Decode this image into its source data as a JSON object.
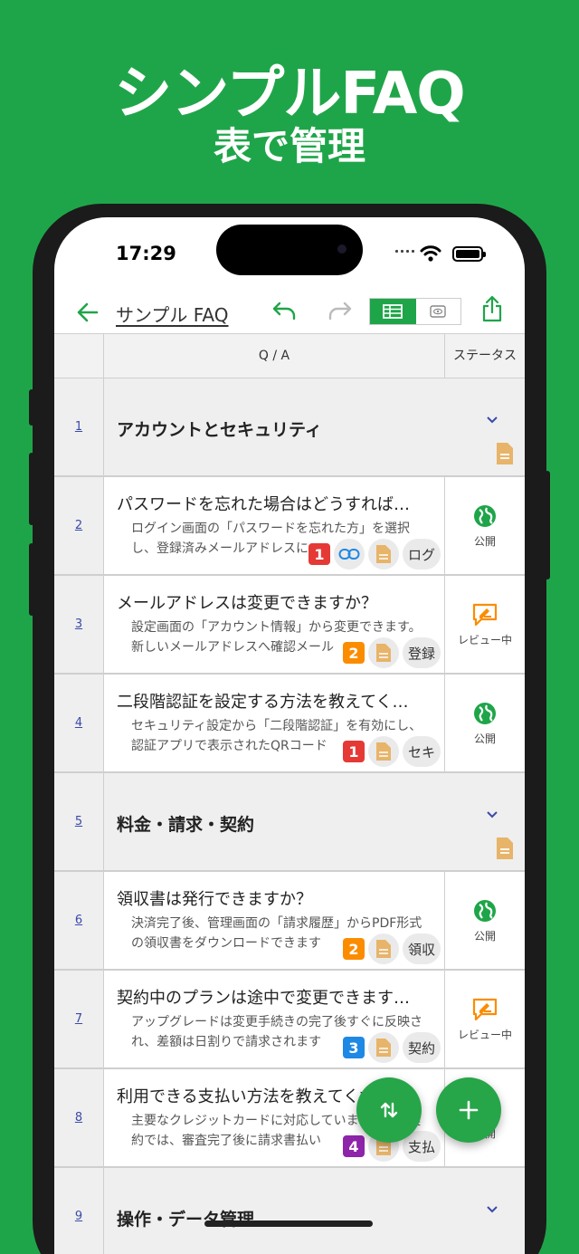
{
  "hero": {
    "title": "シンプルFAQ",
    "subtitle": "表で管理"
  },
  "status_bar": {
    "time": "17:29"
  },
  "toolbar": {
    "title": "サンプル FAQ"
  },
  "table": {
    "header": {
      "qa": "Q / A",
      "status": "ステータス"
    },
    "rows": [
      {
        "num": "1",
        "type": "section",
        "title": "アカウントとセキュリティ"
      },
      {
        "num": "2",
        "type": "item",
        "q": "パスワードを忘れた場合はどうすれば…",
        "a": "ログイン画面の「パスワードを忘れた方」を選択し、登録済みメールアドレスに",
        "badge": "1",
        "badge_color": "#e53935",
        "has_link": true,
        "tag": "ログ",
        "status": "公開",
        "status_icon": "globe-icon"
      },
      {
        "num": "3",
        "type": "item",
        "q": "メールアドレスは変更できますか？",
        "a": "設定画面の「アカウント情報」から変更できます。新しいメールアドレスへ確認メール",
        "badge": "2",
        "badge_color": "#fb8c00",
        "has_link": false,
        "tag": "登録",
        "status": "レビュー中",
        "status_icon": "review-icon"
      },
      {
        "num": "4",
        "type": "item",
        "q": "二段階認証を設定する方法を教えてく…",
        "a": "セキュリティ設定から「二段階認証」を有効にし、認証アプリで表示されたQRコード",
        "badge": "1",
        "badge_color": "#e53935",
        "has_link": false,
        "tag": "セキ",
        "status": "公開",
        "status_icon": "globe-icon"
      },
      {
        "num": "5",
        "type": "section",
        "title": "料金・請求・契約"
      },
      {
        "num": "6",
        "type": "item",
        "q": "領収書は発行できますか？",
        "a": "決済完了後、管理画面の「請求履歴」からPDF形式の領収書をダウンロードできます",
        "badge": "2",
        "badge_color": "#fb8c00",
        "has_link": false,
        "tag": "領収",
        "status": "公開",
        "status_icon": "globe-icon"
      },
      {
        "num": "7",
        "type": "item",
        "q": "契約中のプランは途中で変更できます…",
        "a": "アップグレードは変更手続きの完了後すぐに反映され、差額は日割りで請求されます",
        "badge": "3",
        "badge_color": "#1e88e5",
        "has_link": false,
        "tag": "契約",
        "status": "レビュー中",
        "status_icon": "review-icon"
      },
      {
        "num": "8",
        "type": "item",
        "q": "利用できる支払い方法を教えてください",
        "a": "主要なクレジットカードに対応しています。法人契約では、審査完了後に請求書払い",
        "badge": "4",
        "badge_color": "#8e24aa",
        "has_link": false,
        "tag": "支払",
        "status": "公開",
        "status_icon": "globe-icon"
      },
      {
        "num": "9",
        "type": "section",
        "title": "操作・データ管理"
      }
    ]
  },
  "colors": {
    "brand": "#1fa549",
    "doc": "#e7b46a",
    "link": "#1e88e5"
  }
}
